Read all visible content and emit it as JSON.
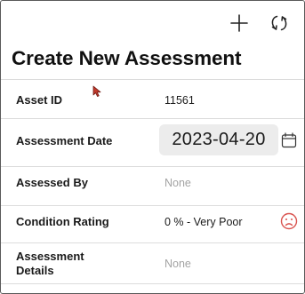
{
  "toolbar": {
    "add_icon": "plus-icon",
    "refresh_icon": "refresh-icon"
  },
  "page": {
    "title": "Create New Assessment"
  },
  "form": {
    "asset_id": {
      "label": "Asset ID",
      "value": "11561"
    },
    "assessment_date": {
      "label": "Assessment Date",
      "value": "2023-04-20",
      "icon": "calendar-icon"
    },
    "assessed_by": {
      "label": "Assessed By",
      "placeholder": "None"
    },
    "condition_rating": {
      "label": "Condition Rating",
      "value": "0 % - Very Poor",
      "icon": "sad-face-icon",
      "icon_color": "#d9534f"
    },
    "assessment_details": {
      "label_line1": "Assessment",
      "label_line2": "Details",
      "placeholder": "None"
    }
  },
  "colors": {
    "divider": "#dcdcdc",
    "placeholder": "#a3a3a3",
    "date_pill_bg": "#ececec",
    "cursor": "#c0392b"
  }
}
